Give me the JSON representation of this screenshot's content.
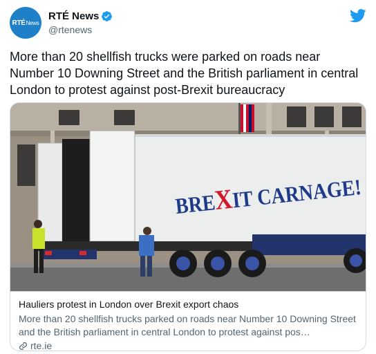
{
  "tweet": {
    "author": {
      "avatar_text_main": "RTÉ",
      "avatar_text_sub": "News",
      "display_name": "RTÉ News",
      "handle": "@rtenews",
      "verified": true
    },
    "text": "More than 20 shellfish trucks were parked on roads near Number 10 Downing Street and the British parliament in central London to protest against post-Brexit bureaucracy",
    "card": {
      "image_truck_text": "BREXIT CARNAGE!",
      "title": "Hauliers protest in London over Brexit export chaos",
      "description": "More than 20 shellfish trucks parked on roads near Number 10 Downing Street and the British parliament in central London to protest against pos…",
      "domain": "rte.ie"
    }
  },
  "colors": {
    "twitter_blue": "#1d9bf0",
    "avatar_bg": "#1e80c8",
    "secondary_text": "#536471",
    "border": "#cfd9de"
  },
  "icons": {
    "brand": "twitter-bird-icon",
    "verified": "verified-badge-icon",
    "link": "link-icon"
  }
}
